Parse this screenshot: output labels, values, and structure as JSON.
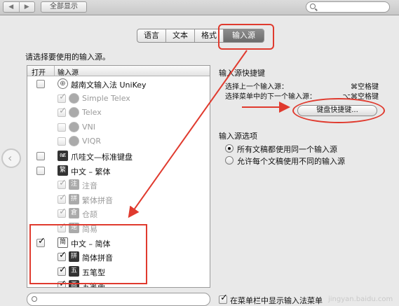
{
  "toolbar": {
    "back_arrow": "◀",
    "forward_arrow": "▶",
    "show_all_label": "全部显示"
  },
  "tabs": [
    {
      "label": "语言",
      "active": false
    },
    {
      "label": "文本",
      "active": false
    },
    {
      "label": "格式",
      "active": false
    },
    {
      "label": "输入源",
      "active": true
    }
  ],
  "prompt": "请选择要使用的输入源。",
  "list": {
    "header_enabled": "打开",
    "header_source": "输入源",
    "rows": [
      {
        "label": "越南文输入法 UniKey",
        "icon": "globe",
        "icon_text": "⊕",
        "checked": false,
        "sub": false,
        "dim": false
      },
      {
        "label": "Simple Telex",
        "icon": "globe",
        "icon_text": "⊕",
        "checked": true,
        "sub": true,
        "dim": true
      },
      {
        "label": "Telex",
        "icon": "globe",
        "icon_text": "⊕",
        "checked": true,
        "sub": true,
        "dim": true
      },
      {
        "label": "VNI",
        "icon": "globe",
        "icon_text": "⊕",
        "checked": false,
        "sub": true,
        "dim": true
      },
      {
        "label": "VIQR",
        "icon": "globe",
        "icon_text": "⊕",
        "checked": false,
        "sub": true,
        "dim": true
      },
      {
        "label": "爪哇文—标准键盘",
        "icon": "key",
        "icon_text": "ꦗ",
        "checked": false,
        "sub": false,
        "dim": false
      },
      {
        "label": "中文 – 繁体",
        "icon": "key",
        "icon_text": "繁",
        "checked": false,
        "sub": false,
        "dim": false
      },
      {
        "label": "注音",
        "icon": "key",
        "icon_text": "注",
        "checked": true,
        "sub": true,
        "dim": true
      },
      {
        "label": "繁体拼音",
        "icon": "key",
        "icon_text": "拼",
        "checked": true,
        "sub": true,
        "dim": true
      },
      {
        "label": "仓颉",
        "icon": "key",
        "icon_text": "倉",
        "checked": true,
        "sub": true,
        "dim": true
      },
      {
        "label": "简易",
        "icon": "key",
        "icon_text": "速",
        "checked": true,
        "sub": true,
        "dim": true
      },
      {
        "label": "中文 – 简体",
        "icon": "ghost",
        "icon_text": "简",
        "checked": true,
        "sub": false,
        "dim": false
      },
      {
        "label": "简体拼音",
        "icon": "key",
        "icon_text": "拼",
        "checked": true,
        "sub": true,
        "dim": false
      },
      {
        "label": "五笔型",
        "icon": "key",
        "icon_text": "五",
        "checked": true,
        "sub": true,
        "dim": false
      },
      {
        "label": "五笔画",
        "icon": "key",
        "icon_text": "画",
        "checked": true,
        "sub": true,
        "dim": false
      }
    ]
  },
  "shortcuts": {
    "title": "输入源快捷键",
    "prev_label": "选择上一个输入源：",
    "prev_key": "⌘空格键",
    "next_label": "选择菜单中的下一个输入源：",
    "next_key": "⌥⌘空格键",
    "keyboard_shortcuts_button": "键盘快捷键..."
  },
  "options": {
    "title": "输入源选项",
    "same_for_all": "所有文稿都使用同一个输入源",
    "per_document": "允许每个文稿使用不同的输入源",
    "selected": "same_for_all"
  },
  "menubar_checkbox_label": "在菜单栏中显示输入法菜单",
  "side_nav_arrow": "‹",
  "watermark": "jingyan.baidu.com",
  "colors": {
    "annotation": "#e03a2e",
    "active_tab": "#7a7a7a",
    "background": "#e9e9e9"
  }
}
